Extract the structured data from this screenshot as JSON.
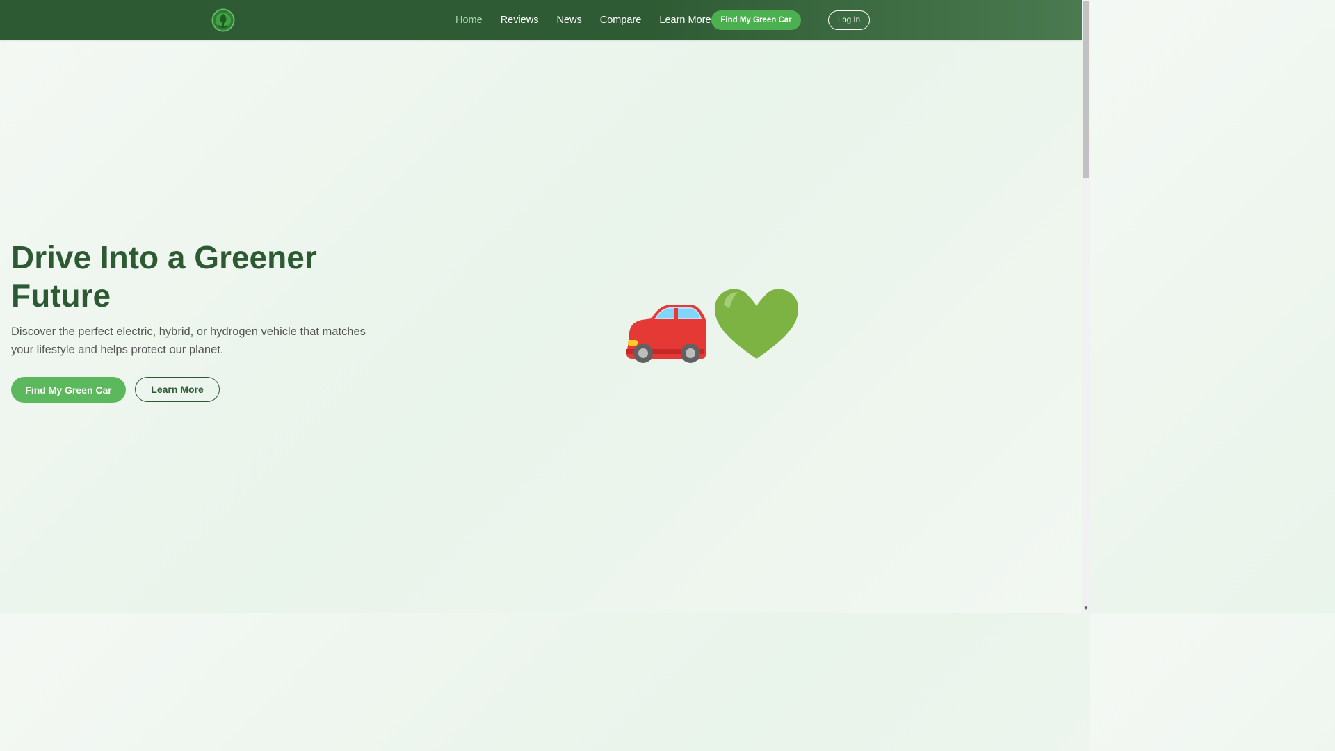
{
  "nav": {
    "links": [
      {
        "label": "Home",
        "active": true
      },
      {
        "label": "Reviews",
        "active": false
      },
      {
        "label": "News",
        "active": false
      },
      {
        "label": "Compare",
        "active": false
      },
      {
        "label": "Learn More",
        "active": false
      }
    ],
    "cta_label": "Find My Green Car",
    "login_label": "Log In"
  },
  "hero": {
    "title": "Drive Into a Greener Future",
    "subtitle": "Discover the perfect electric, hybrid, or hydrogen vehicle that matches your lifestyle and helps protect our planet.",
    "primary_button": "Find My Green Car",
    "secondary_button": "Learn More",
    "illustration_icons": [
      "car-icon",
      "green-heart-icon"
    ]
  },
  "colors": {
    "nav_background": "#2d5a33",
    "accent_green": "#5cb85c",
    "title_green": "#2d5a33",
    "active_link": "#a5d6a7"
  }
}
